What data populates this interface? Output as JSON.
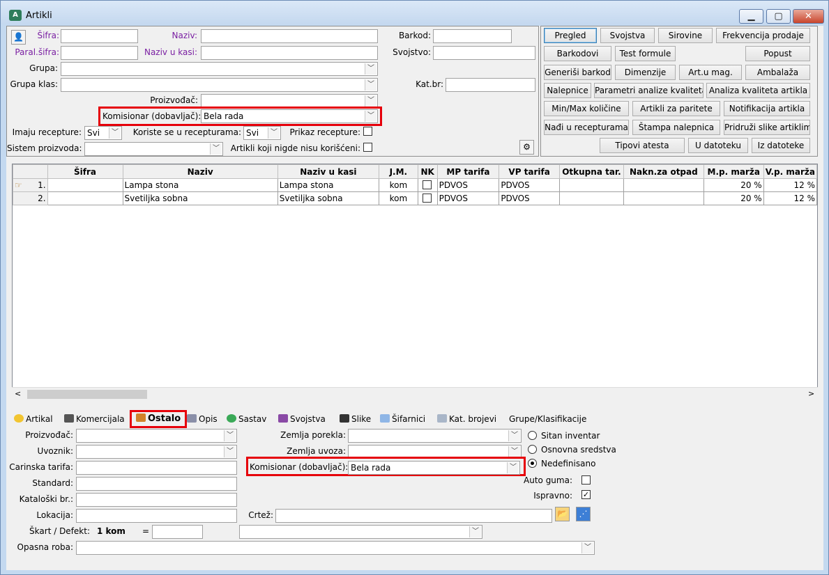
{
  "window": {
    "title": "Artikli",
    "app_icon": "app-logo-icon",
    "min": "▁",
    "max": "▢",
    "close": "✕"
  },
  "filter": {
    "sifra_label": "Šifra:",
    "naziv_label": "Naziv:",
    "barkod_label": "Barkod:",
    "paral_label": "Paral.šifra:",
    "naziv_kasi_label": "Naziv u kasi:",
    "svojstvo_label": "Svojstvo:",
    "grupa_label": "Grupa:",
    "grupa_klas_label": "Grupa klas:",
    "kat_br_label": "Kat.br:",
    "proizvodjac_label": "Proizvođač:",
    "komisionar_label": "Komisionar (dobavljač):",
    "komisionar_value": "Bela rada",
    "imaju_label": "Imaju recepture:",
    "imaju_value": "Svi",
    "koriste_label": "Koriste se u recepturama:",
    "koriste_value": "Svi",
    "prikaz_label": "Prikaz recepture:",
    "sistem_label": "Sistem proizvoda:",
    "nigde_label": "Artikli koji nigde nisu korišćeni:"
  },
  "buttons": {
    "pregled": "Pregled",
    "svojstva": "Svojstva",
    "sirovine": "Sirovine",
    "frekvencija": "Frekvencija prodaje",
    "barkodovi": "Barkodovi",
    "test_formule": "Test formule",
    "popust": "Popust",
    "generisi": "Generiši barkod",
    "dimenzije": "Dimenzije",
    "art_mag": "Art.u mag.",
    "ambalaza": "Ambalaža",
    "nalepnice": "Nalepnice",
    "parametri": "Parametri analize kvaliteta",
    "analiza": "Analiza kvaliteta artikla",
    "minmax": "Min/Max količine",
    "paritete": "Artikli za paritete",
    "notifikacija": "Notifikacija artikla",
    "nadji": "Nađi u recepturama",
    "stampa": "Štampa nalepnica",
    "pridruzi": "Pridruži slike artiklima",
    "tipovi": "Tipovi atesta",
    "u_datoteku": "U datoteku",
    "iz_datoteke": "Iz datoteke"
  },
  "grid": {
    "columns": [
      "Šifra",
      "Naziv",
      "Naziv u kasi",
      "J.M.",
      "NK",
      "MP tarifa",
      "VP tarifa",
      "Otkupna tar.",
      "Nakn.za otpad",
      "M.p. marža",
      "V.p. marža"
    ],
    "rows": [
      {
        "n": "1.",
        "sifra": "",
        "naziv": "Lampa stona",
        "kasi": "Lampa stona",
        "jm": "kom",
        "mp": "PDVOS",
        "vp": "PDVOS",
        "otk": "",
        "nakn": "",
        "mpm": "20 %",
        "vpm": "12 %"
      },
      {
        "n": "2.",
        "sifra": "",
        "naziv": "Svetiljka sobna",
        "kasi": "Svetiljka sobna",
        "jm": "kom",
        "mp": "PDVOS",
        "vp": "PDVOS",
        "otk": "",
        "nakn": "",
        "mpm": "20 %",
        "vpm": "12 %"
      }
    ]
  },
  "tabs": [
    "Artikal",
    "Komercijala",
    "Ostalo",
    "Opis",
    "Sastav",
    "Svojstva",
    "Slike",
    "Šifarnici",
    "Kat. brojevi",
    "Grupe/Klasifikacije"
  ],
  "detail": {
    "proizvodjac_label": "Proizvođač:",
    "uvoznik_label": "Uvoznik:",
    "carinska_label": "Carinska tarifa:",
    "standard_label": "Standard:",
    "katalog_label": "Kataloški br.:",
    "lokacija_label": "Lokacija:",
    "skart_label": "Škart / Defekt:",
    "skart_value": "1 kom",
    "eq": "=",
    "opasna_label": "Opasna roba:",
    "zemlja_porekla_label": "Zemlja porekla:",
    "zemlja_uvoza_label": "Zemlja uvoza:",
    "komisionar_label": "Komisionar (dobavljač):",
    "komisionar_value": "Bela rada",
    "crtez_label": "Crtež:",
    "sitan": "Sitan inventar",
    "osnovna": "Osnovna sredstva",
    "nedefinisano": "Nedefinisano",
    "auto_guma": "Auto guma:",
    "ispravno": "Ispravno:"
  }
}
